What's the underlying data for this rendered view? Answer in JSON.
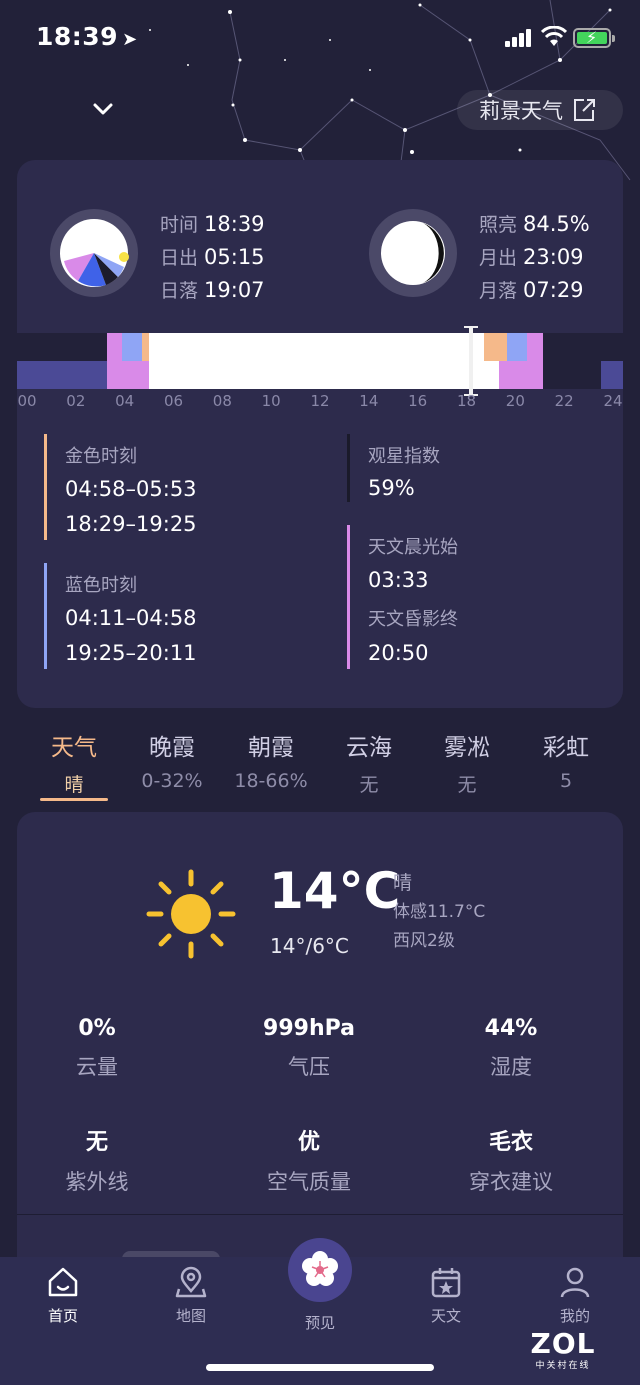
{
  "status_bar": {
    "time": "18:39"
  },
  "header": {
    "brand": "莉景天气"
  },
  "sun_panel": {
    "left": [
      {
        "label": "时间",
        "value": "18:39"
      },
      {
        "label": "日出",
        "value": "05:15"
      },
      {
        "label": "日落",
        "value": "19:07"
      }
    ],
    "right": [
      {
        "label": "照亮",
        "value": "84.5%"
      },
      {
        "label": "月出",
        "value": "23:09"
      },
      {
        "label": "月落",
        "value": "07:29"
      }
    ],
    "timeline_ticks": [
      "00",
      "02",
      "04",
      "06",
      "08",
      "10",
      "12",
      "14",
      "16",
      "18",
      "20",
      "22",
      "24"
    ],
    "current_hour": 18.65,
    "golden_hour": {
      "label": "金色时刻",
      "times": [
        "04:58–05:53",
        "18:29–19:25"
      ],
      "color": "#f5b98a"
    },
    "blue_hour": {
      "label": "蓝色时刻",
      "times": [
        "04:11–04:58",
        "19:25–20:11"
      ],
      "color": "#8fa5f5"
    },
    "stargazing": {
      "label": "观星指数",
      "value": "59%"
    },
    "astronomical": {
      "dawn_label": "天文晨光始",
      "dawn_value": "03:33",
      "dusk_label": "天文昏影终",
      "dusk_value": "20:50",
      "color": "#d98ae8"
    }
  },
  "tabs": [
    {
      "label": "天气",
      "sub": "晴",
      "active": true
    },
    {
      "label": "晚霞",
      "sub": "0-32%"
    },
    {
      "label": "朝霞",
      "sub": "18-66%"
    },
    {
      "label": "云海",
      "sub": "无"
    },
    {
      "label": "雾凇",
      "sub": "无"
    },
    {
      "label": "彩虹",
      "sub": "5"
    }
  ],
  "weather": {
    "temperature": "14°C",
    "range": "14°/6°C",
    "condition": "晴",
    "feels_like": "体感11.7°C",
    "wind": "西风2级",
    "stats": [
      {
        "value": "0%",
        "label": "云量"
      },
      {
        "value": "999hPa",
        "label": "气压"
      },
      {
        "value": "44%",
        "label": "湿度"
      },
      {
        "value": "无",
        "label": "紫外线"
      },
      {
        "value": "优",
        "label": "空气质量"
      },
      {
        "value": "毛衣",
        "label": "穿衣建议"
      }
    ]
  },
  "nav": [
    {
      "label": "首页",
      "icon": "home-icon",
      "active": true
    },
    {
      "label": "地图",
      "icon": "map-pin-icon"
    },
    {
      "label": "预见",
      "icon": "flower-icon"
    },
    {
      "label": "天文",
      "icon": "calendar-star-icon"
    },
    {
      "label": "我的",
      "icon": "user-icon"
    }
  ],
  "watermark": {
    "brand": "ZOL",
    "tagline": "中关村在线"
  },
  "colors": {
    "background": "#222139",
    "card": "#2d2b4c",
    "accent": "#f5b98a",
    "nav": "#2e2d52"
  }
}
